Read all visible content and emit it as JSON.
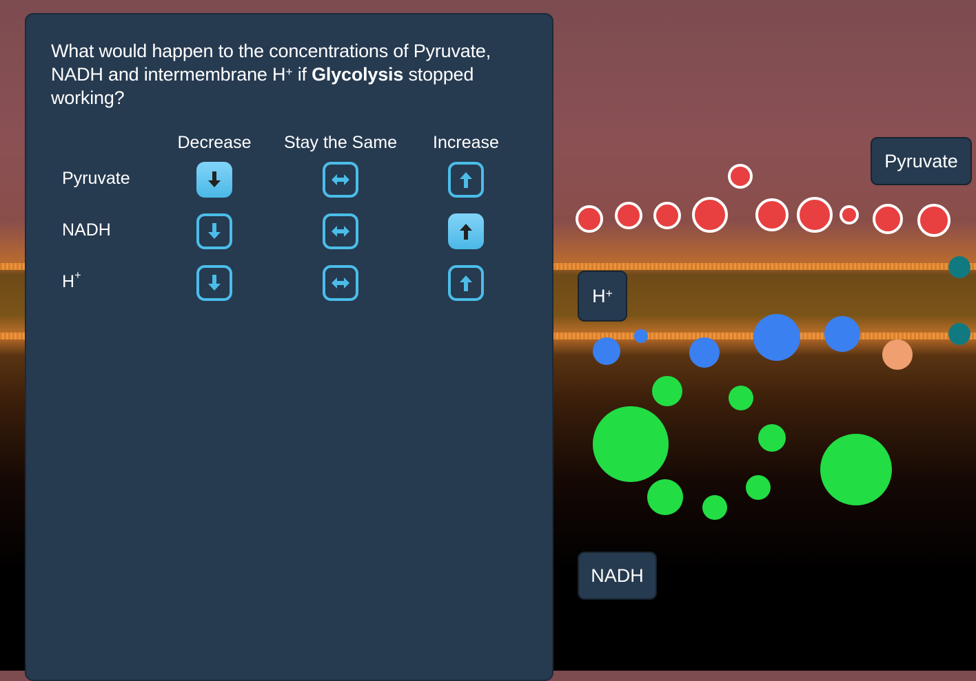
{
  "question": {
    "pre": "What would happen to the concentrations of Pyruvate, NADH and intermembrane H",
    "sup": "+",
    "mid": " if ",
    "bold": "Glycolysis",
    "post": " stopped working?"
  },
  "columns": [
    "Decrease",
    "Stay the Same",
    "Increase"
  ],
  "rows": [
    {
      "label": "Pyruvate",
      "sup": "",
      "selected": "Decrease"
    },
    {
      "label": "NADH",
      "sup": "",
      "selected": "Increase"
    },
    {
      "label": "H",
      "sup": "+",
      "selected": null
    }
  ],
  "scene_labels": {
    "pyruvate": "Pyruvate",
    "hplus": "H",
    "hplus_sup": "+",
    "nadh": "NADH"
  },
  "colors": {
    "panel": "#263a50",
    "accent": "#4bbde8",
    "pyruvate": "#e84040",
    "protein": "#3a80f0",
    "nadh": "#22dd44"
  }
}
